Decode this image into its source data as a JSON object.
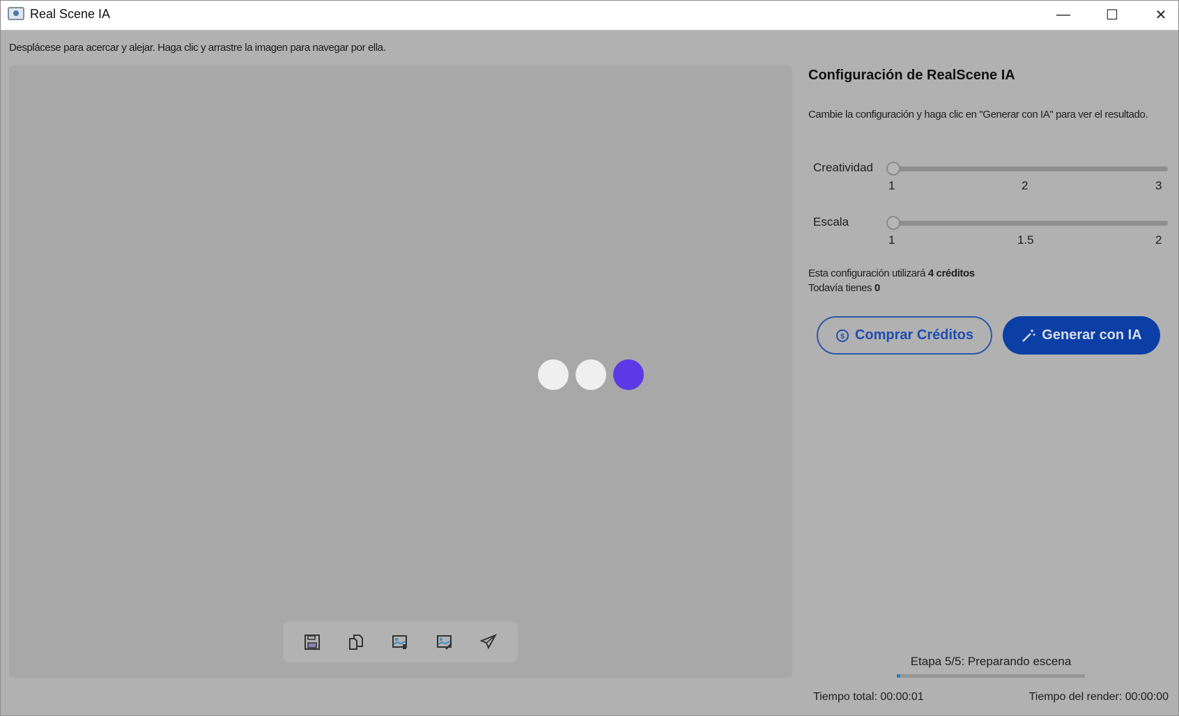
{
  "window": {
    "title": "Real Scene IA",
    "minimize": "—",
    "maximize": "☐",
    "close": "✕"
  },
  "viewer": {
    "hint": "Desplácese para acercar y alejar. Haga clic y arrastre la imagen para navegar por ella.",
    "loading_dots": [
      "#efefef",
      "#efefef",
      "#5b3ae6"
    ],
    "toolbar": [
      "save",
      "copy",
      "image-export",
      "image-edit",
      "send"
    ]
  },
  "panel": {
    "title": "Configuración de RealScene IA",
    "description": "Cambie la configuración y haga clic en \"Generar con IA\" para ver el resultado.",
    "sliders": [
      {
        "label": "Creatividad",
        "ticks": [
          "1",
          "2",
          "3"
        ],
        "value": 1,
        "min": 1,
        "max": 3
      },
      {
        "label": "Escala",
        "ticks": [
          "1",
          "1.5",
          "2"
        ],
        "value": 1,
        "min": 1,
        "max": 2
      }
    ],
    "credits_prefix": "Esta configuración utilizará ",
    "credits_value": "4 créditos",
    "remaining_prefix": "Todavía tienes ",
    "remaining_value": "0",
    "buy_button": "Comprar Créditos",
    "generate_button": "Generar con IA"
  },
  "status": {
    "stage": "Etapa 5/5: Preparando escena",
    "progress": 0.02,
    "total_time": "Tiempo total: 00:00:01",
    "render_time": "Tiempo del render: 00:00:00"
  },
  "colors": {
    "accent": "#0b3fa6",
    "progress": "#2d7fc0"
  }
}
